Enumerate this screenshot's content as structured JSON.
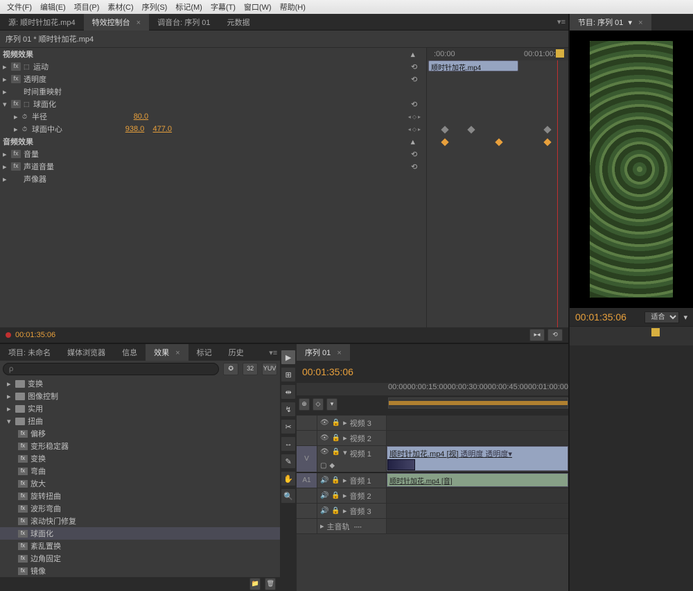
{
  "menu": {
    "file": "文件(F)",
    "edit": "编辑(E)",
    "project": "项目(P)",
    "clip": "素材(C)",
    "sequence": "序列(S)",
    "marker": "标记(M)",
    "title": "字幕(T)",
    "window": "窗口(W)",
    "help": "帮助(H)"
  },
  "source_tabs": {
    "source": "源: 顺时针加花.mp4",
    "effect_controls": "特效控制台",
    "audio_mixer": "调音台: 序列 01",
    "metadata": "元数据"
  },
  "effect_controls": {
    "title": "序列 01 * 顺时针加花.mp4",
    "ruler": {
      "t0": ":00:00",
      "t1": "00:01:00:00"
    },
    "clip_name": "顺时针加花.mp4",
    "video_effects_header": "视频效果",
    "effects": {
      "motion": "运动",
      "opacity": "透明度",
      "time_remap": "时间重映射",
      "spherize": "球面化",
      "radius": {
        "label": "半径",
        "value": "80.0"
      },
      "center": {
        "label": "球面中心",
        "x": "938.0",
        "y": "477.0"
      }
    },
    "audio_effects_header": "音频效果",
    "audio": {
      "volume": "音量",
      "channel_volume": "声道音量",
      "panner": "声像器"
    },
    "timecode": "00:01:35:06"
  },
  "project_panel": {
    "tabs": {
      "project": "项目: 未命名",
      "browser": "媒体浏览器",
      "info": "信息",
      "effects": "效果",
      "markers": "标记",
      "history": "历史"
    },
    "search_placeholder": "ρ",
    "tree": {
      "transform": "变换",
      "image_control": "图像控制",
      "utility": "实用",
      "distort": "扭曲",
      "items": {
        "offset": "偏移",
        "warp_stabilizer": "变形稳定器",
        "transform2": "变换",
        "bend": "弯曲",
        "magnify": "放大",
        "twirl": "旋转扭曲",
        "wave_warp": "波形弯曲",
        "rolling_shutter": "滚动快门修复",
        "spherize": "球面化",
        "turbulent": "紊乱置换",
        "corner_pin": "边角固定",
        "mirror": "镜像"
      }
    }
  },
  "timeline": {
    "tab": "序列 01",
    "timecode": "00:01:35:06",
    "ruler": [
      "00:00",
      "00:00:15:00",
      "00:00:30:00",
      "00:00:45:00",
      "00:01:00:00"
    ],
    "tracks": {
      "v3": "视频 3",
      "v2": "视频 2",
      "v1": "视频 1",
      "a1": "音频 1",
      "a2": "音频 2",
      "a3": "音频 3",
      "master": "主音轨"
    },
    "track_label_v": "V",
    "track_label_a1": "A1",
    "clip_video": "顺时针加花.mp4 [视]",
    "clip_video_suffix": "透明度 透明度▾",
    "clip_audio": "顺时针加花.mp4 [音]"
  },
  "program_monitor": {
    "tab": "节目: 序列 01",
    "timecode": "00:01:35:06",
    "zoom": "适合"
  }
}
